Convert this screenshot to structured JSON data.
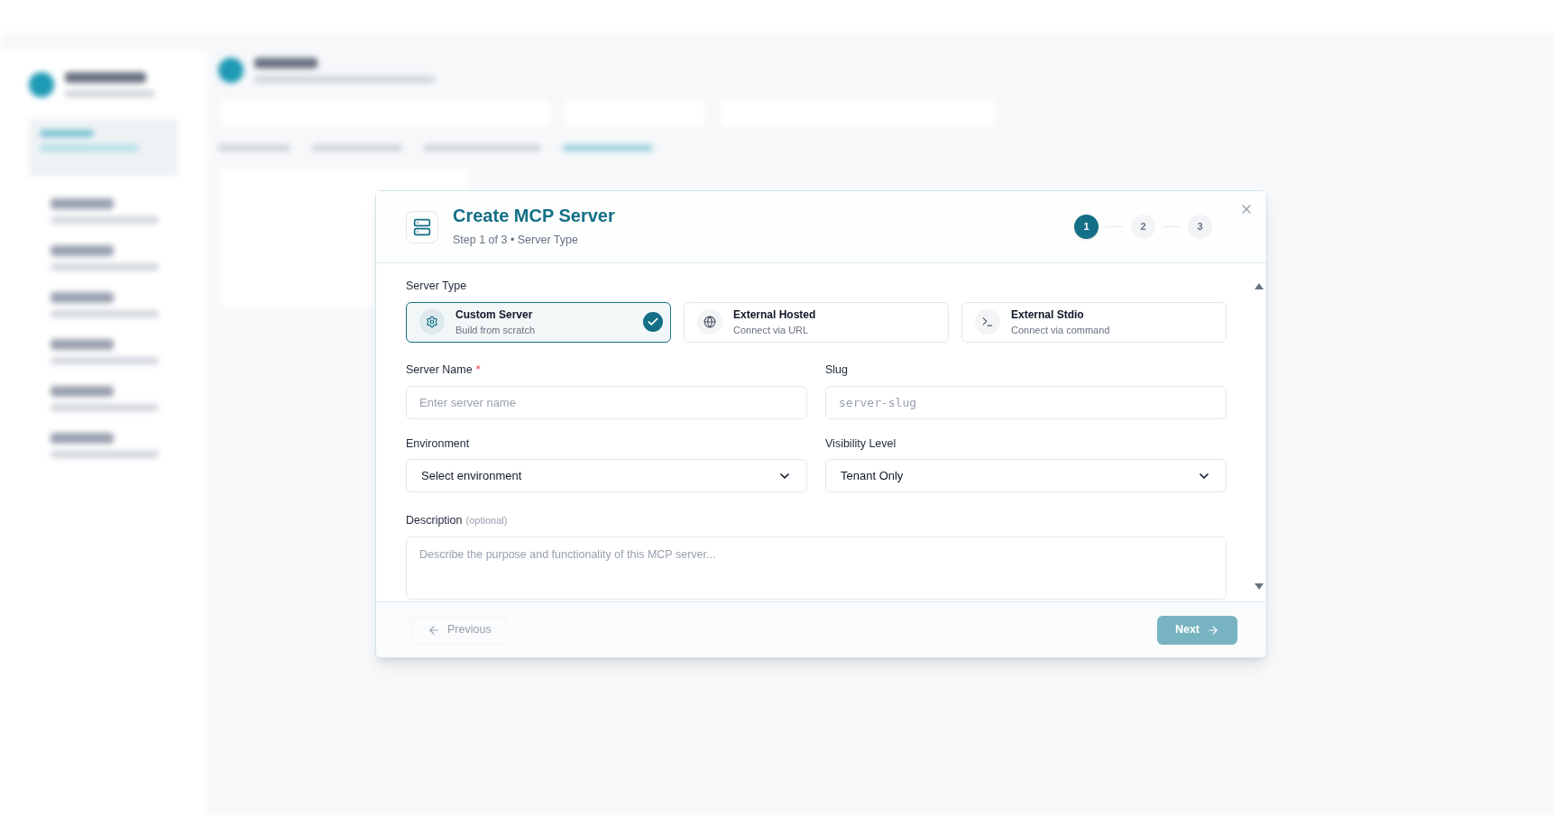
{
  "modal": {
    "title": "Create MCP Server",
    "subtitle": "Step 1 of 3 • Server Type",
    "steps": [
      {
        "label": "1",
        "selected": true
      },
      {
        "label": "2",
        "selected": false
      },
      {
        "label": "3",
        "selected": false
      }
    ],
    "server_type": {
      "label": "Server Type",
      "options": [
        {
          "kind": "gear",
          "title": "Custom Server",
          "subtitle": "Build from scratch",
          "selected": true
        },
        {
          "kind": "globe",
          "title": "External Hosted",
          "subtitle": "Connect via URL",
          "selected": false
        },
        {
          "kind": "terminal",
          "title": "External Stdio",
          "subtitle": "Connect via command",
          "selected": false
        }
      ]
    },
    "fields": [
      {
        "kind": "text",
        "label": "Server Name",
        "required_mark": "*",
        "placeholder": "Enter server name"
      },
      {
        "kind": "code",
        "label": "Slug",
        "placeholder": "server-slug"
      },
      {
        "kind": "select",
        "label": "Environment",
        "value": "Select environment"
      },
      {
        "kind": "select",
        "label": "Visibility Level",
        "value": "Tenant Only"
      }
    ],
    "description": {
      "label": "Description",
      "note": "(optional)",
      "placeholder": "Describe the purpose and functionality of this MCP server..."
    },
    "previous": {
      "label": "Previous",
      "disabled": true
    },
    "next": {
      "label": "Next"
    }
  }
}
